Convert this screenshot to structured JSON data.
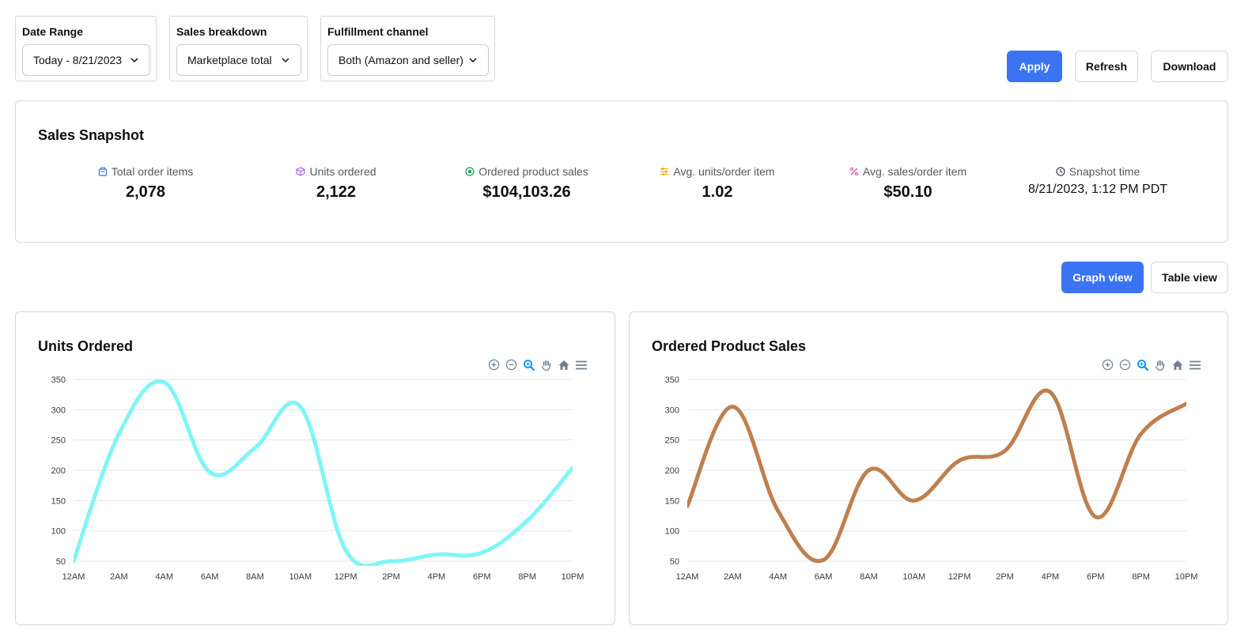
{
  "filters": {
    "date_range": {
      "label": "Date Range",
      "value": "Today - 8/21/2023"
    },
    "sales_breakdown": {
      "label": "Sales breakdown",
      "value": "Marketplace total"
    },
    "fulfillment": {
      "label": "Fulfillment channel",
      "value": "Both (Amazon and seller)"
    }
  },
  "actions": {
    "apply": "Apply",
    "refresh": "Refresh",
    "download": "Download"
  },
  "snapshot": {
    "title": "Sales Snapshot",
    "metrics": [
      {
        "label": "Total order items",
        "value": "2,078",
        "icon": "shopping-bag-icon",
        "color": "#2f7bd6"
      },
      {
        "label": "Units ordered",
        "value": "2,122",
        "icon": "cube-icon",
        "color": "#a855f7"
      },
      {
        "label": "Ordered product sales",
        "value": "$104,103.26",
        "icon": "dollar-circle-icon",
        "color": "#16a34a"
      },
      {
        "label": "Avg. units/order item",
        "value": "1.02",
        "icon": "sliders-icon",
        "color": "#eab308"
      },
      {
        "label": "Avg. sales/order item",
        "value": "$50.10",
        "icon": "percent-icon",
        "color": "#ec4899"
      },
      {
        "label": "Snapshot time",
        "value": "8/21/2023, 1:12 PM PDT",
        "icon": "clock-icon",
        "color": "#374151"
      }
    ]
  },
  "views": {
    "graph": "Graph view",
    "table": "Table view"
  },
  "toolbar_icons": [
    "zoom-in-icon",
    "zoom-out-icon",
    "selection-zoom-icon",
    "pan-hand-icon",
    "reset-home-icon",
    "menu-icon"
  ],
  "chart_data": [
    {
      "type": "line",
      "title": "Units Ordered",
      "color": "#7ff5f8",
      "categories": [
        "12AM",
        "2AM",
        "4AM",
        "6AM",
        "8AM",
        "10AM",
        "12PM",
        "2PM",
        "4PM",
        "6PM",
        "8PM",
        "10PM"
      ],
      "series": [
        {
          "values": [
            50,
            260,
            345,
            197,
            237,
            305,
            68,
            50,
            61,
            64,
            117,
            204
          ]
        }
      ],
      "yticks": [
        50,
        100,
        150,
        200,
        250,
        300,
        350
      ],
      "ylim": [
        50,
        350
      ]
    },
    {
      "type": "line",
      "title": "Ordered Product Sales",
      "color": "#c07f4e",
      "categories": [
        "12AM",
        "2AM",
        "4AM",
        "6AM",
        "8AM",
        "10AM",
        "12PM",
        "2PM",
        "4PM",
        "6PM",
        "8PM",
        "10PM"
      ],
      "series": [
        {
          "values": [
            141,
            305,
            133,
            52,
            200,
            150,
            216,
            232,
            329,
            123,
            260,
            310
          ]
        }
      ],
      "yticks": [
        50,
        100,
        150,
        200,
        250,
        300,
        350
      ],
      "ylim": [
        50,
        350
      ]
    }
  ]
}
